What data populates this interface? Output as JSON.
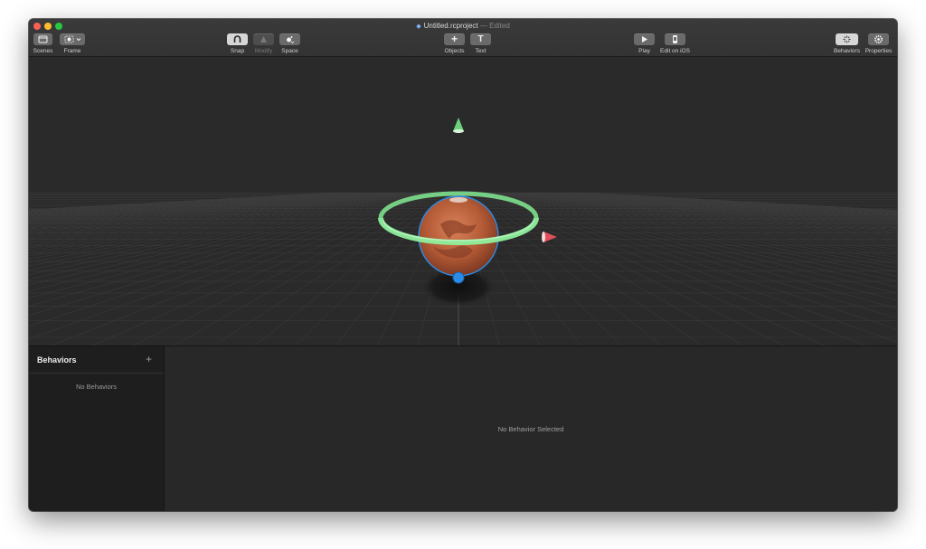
{
  "window": {
    "title": "Untitled.rcproject",
    "status": "— Edited"
  },
  "toolbar": {
    "scenes_label": "Scenes",
    "frame_label": "Frame",
    "snap_label": "Snap",
    "modify_label": "Modify",
    "space_label": "Space",
    "objects_label": "Objects",
    "text_label": "Text",
    "text_glyph": "T",
    "add_glyph": "+",
    "play_label": "Play",
    "edit_ios_label": "Edit on iOS",
    "behaviors_label": "Behaviors",
    "properties_label": "Properties",
    "icons": [
      "scenes-icon",
      "frame-icon",
      "snap-icon",
      "modify-icon",
      "space-icon",
      "add-icon",
      "text-icon",
      "play-icon",
      "device-icon",
      "behaviors-icon",
      "gear-icon"
    ]
  },
  "sidebar": {
    "title": "Behaviors",
    "add_glyph": "+",
    "empty_text": "No Behaviors"
  },
  "detail": {
    "empty_text": "No Behavior Selected"
  },
  "scene": {
    "object": "mars-sphere",
    "colors": {
      "rotation_ring": "#7ee08e",
      "y_axis_handle": "#6ed27c",
      "x_axis_handle": "#e0505c",
      "selection_outline": "#2b8ce8",
      "planet": "#c2643e"
    }
  }
}
